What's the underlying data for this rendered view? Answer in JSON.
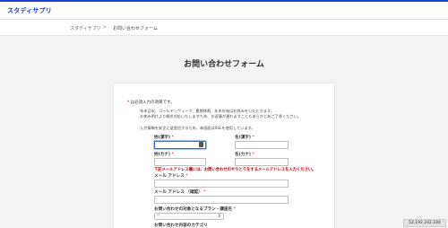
{
  "header": {
    "logo": "スタディサプリ"
  },
  "breadcrumb": {
    "home": "スタディサプリ",
    "separator": ">",
    "current": "お問い合わせフォーム"
  },
  "page": {
    "title": "お問い合わせフォーム"
  },
  "form": {
    "required_note_star": "*",
    "required_note": "は必須入力の項目です。",
    "notice_line1": "年末日祝、ゴールデンウィーク、夏期休暇、年末年始はお休みをいただきます。",
    "notice_line2": "お休み明けより順次対応いたしますため、お返事が遅れますこともあらかじめご了承ください。",
    "notice_line3": "入力情報を安全に送受信するため、本画面はSSLを使用しています。",
    "last_name_kanji": {
      "label": "姓(漢字)",
      "value": ""
    },
    "first_name_kanji": {
      "label": "名(漢字)",
      "value": ""
    },
    "last_name_kana": {
      "label": "姓(カナ)",
      "value": ""
    },
    "first_name_kana": {
      "label": "名(カナ)",
      "value": ""
    },
    "email_warning": "下記メールアドレス欄には、お問い合わせのやりとりをするメールアドレスを入力ください。",
    "email": {
      "label": "メール アドレス",
      "value": ""
    },
    "email_confirm": {
      "label": "メール アドレス （確認）",
      "value": ""
    },
    "plan": {
      "label": "お問い合わせの対象となるプラン・講座名",
      "selected": "--"
    },
    "category": {
      "label": "お問い合わせ内容のカテゴリ"
    },
    "star": "*"
  },
  "status": {
    "ip": "52.192.242.184"
  },
  "colors": {
    "accent": "#1b3fd1",
    "required": "#cc0000"
  }
}
